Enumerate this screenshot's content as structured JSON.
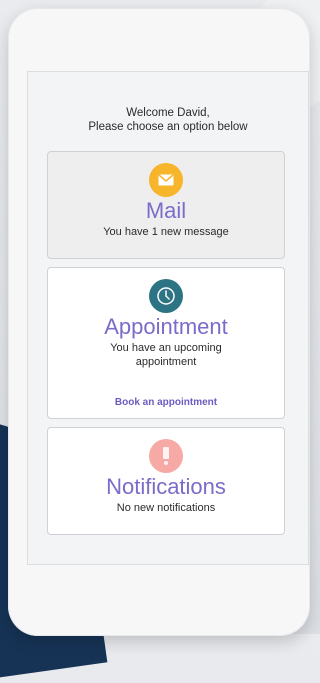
{
  "welcome": {
    "line1": "Welcome David,",
    "line2": "Please choose an option below"
  },
  "cards": {
    "mail": {
      "title": "Mail",
      "subtitle": "You have 1 new message",
      "icon": "mail-icon",
      "icon_color": "#f6b52a"
    },
    "appointment": {
      "title": "Appointment",
      "subtitle": "You have an upcoming appointment",
      "link": "Book an appointment",
      "icon": "clock-icon",
      "icon_color": "#2c7384"
    },
    "notifications": {
      "title": "Notifications",
      "subtitle": "No new notifications",
      "icon": "notification-icon",
      "icon_color": "#f7a9a5"
    }
  },
  "colors": {
    "accent": "#7a6cc9",
    "link": "#6a5cc1",
    "background_dark": "#163356"
  }
}
